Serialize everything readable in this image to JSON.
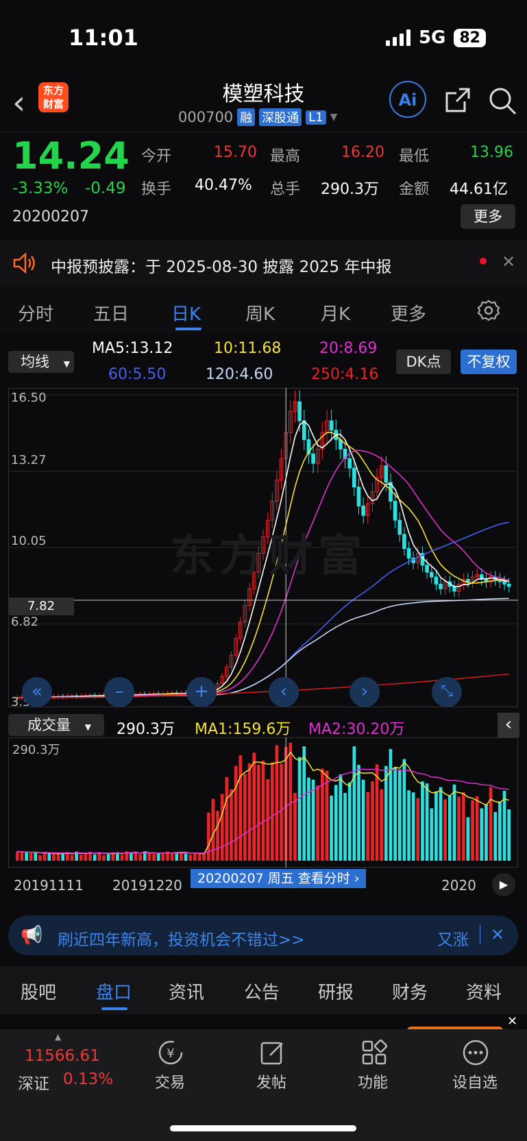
{
  "status": {
    "time": "11:01",
    "network": "5G",
    "battery": "82"
  },
  "header": {
    "logo_text": "东方财富",
    "title": "模塑科技",
    "code": "000700",
    "tags": [
      "融",
      "深股通",
      "L1"
    ],
    "ai_label": "Ai"
  },
  "quote": {
    "price": "14.24",
    "change_pct": "-3.33%",
    "change": "-0.49",
    "date": "20200207",
    "open_label": "今开",
    "open": "15.70",
    "high_label": "最高",
    "high": "16.20",
    "low_label": "最低",
    "low": "13.96",
    "turnover_label": "换手",
    "turnover": "40.47%",
    "volume_label": "总手",
    "volume": "290.3万",
    "amount_label": "金额",
    "amount": "44.61亿",
    "more": "更多"
  },
  "notice": {
    "text": "中报预披露：于 2025-08-30 披露 2025 年中报"
  },
  "tabs": [
    "分时",
    "五日",
    "日K",
    "周K",
    "月K",
    "更多"
  ],
  "indicator": {
    "select": "均线",
    "ma5": "MA5:13.12",
    "ma10": "10:11.68",
    "ma20": "20:8.69",
    "ma60": "60:5.50",
    "ma120": "120:4.60",
    "ma250": "250:4.16",
    "dk": "DK点",
    "fq": "不复权"
  },
  "chart_data": {
    "type": "candlestick",
    "y_ticks": [
      "16.50",
      "13.27",
      "10.05",
      "6.82",
      "3.59"
    ],
    "ylim": [
      3.59,
      16.5
    ],
    "crosshair_price": "7.82",
    "close": [
      3.7,
      3.72,
      3.71,
      3.73,
      3.72,
      3.74,
      3.75,
      3.73,
      3.74,
      3.76,
      3.75,
      3.77,
      3.78,
      3.76,
      3.77,
      3.79,
      3.8,
      3.78,
      3.79,
      3.81,
      3.8,
      3.82,
      3.81,
      3.83,
      3.84,
      3.82,
      3.83,
      3.85,
      3.84,
      3.86,
      3.87,
      3.85,
      3.86,
      3.88,
      3.9,
      3.88,
      3.89,
      3.87,
      3.88,
      3.9,
      3.92,
      3.95,
      4.0,
      4.1,
      4.3,
      4.6,
      5.0,
      5.5,
      6.2,
      6.9,
      7.6,
      8.3,
      9.0,
      9.8,
      10.5,
      11.2,
      12.0,
      12.9,
      13.8,
      14.9,
      15.8,
      16.2,
      15.4,
      14.6,
      14.0,
      13.6,
      14.2,
      14.9,
      15.4,
      15.0,
      14.6,
      14.2,
      13.8,
      13.4,
      12.6,
      11.8,
      11.4,
      11.9,
      12.4,
      13.0,
      13.5,
      12.8,
      12.0,
      11.2,
      10.6,
      10.0,
      9.6,
      9.4,
      9.8,
      9.3,
      9.0,
      8.8,
      8.5,
      8.3,
      8.6,
      8.4,
      8.2,
      8.5,
      8.7,
      8.6,
      8.8,
      8.9,
      8.7,
      8.6,
      8.8,
      8.7,
      8.6,
      8.5,
      8.4
    ]
  },
  "volume": {
    "select": "成交量",
    "value": "290.3万",
    "ma1": "MA1:159.6万",
    "ma2": "MA2:30.20万",
    "top": "290.3万",
    "dates": [
      "20191111",
      "20191220",
      "20200207 周五 查看分时",
      "2020"
    ]
  },
  "ad": {
    "text": "刷近四年新高，投资机会不错过>>",
    "brand": "又涨"
  },
  "bottom_tabs": [
    "股吧",
    "盘口",
    "资讯",
    "公告",
    "研报",
    "财务",
    "资料"
  ],
  "dock": {
    "index_value": "11566.61",
    "index_name": "深证",
    "index_chg": "0.13%",
    "items": [
      "交易",
      "发帖",
      "功能",
      "设自选"
    ]
  }
}
